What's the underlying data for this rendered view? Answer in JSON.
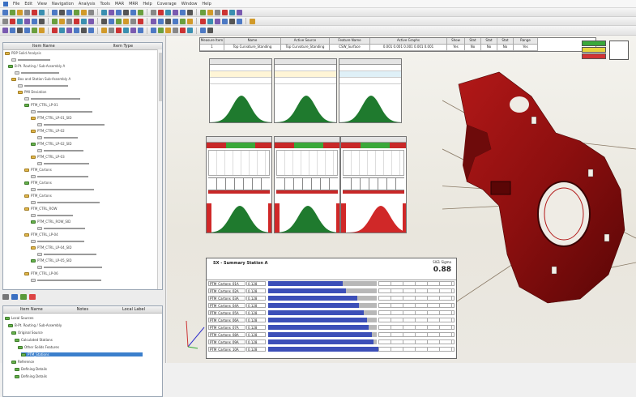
{
  "menubar": {
    "items": [
      "File",
      "Edit",
      "View",
      "Navigation",
      "Analysis",
      "Tools",
      "MAR",
      "MRR",
      "Help",
      "Coverage",
      "Window",
      "Help"
    ]
  },
  "toolbars": {
    "row_count": 3
  },
  "tree_panel": {
    "header_left": "Item Name",
    "header_right": "Item Type",
    "rows": [
      "PDP Solid Analysis",
      "B-Pt. Routing / Sub-Assembly A",
      "Box and Station Sub-Assembly A",
      "PMI Deviation",
      "PTM_CTRL_LP-01",
      "PTM_CTRL_LP-01_SID",
      "PTM_CTRL_LP-02",
      "PTM_CTRL_LP-02_SID",
      "PTM_CTRL_LP-03",
      "PTM_Cartons",
      "PTM_Cartons",
      "PTM_Cartons",
      "PTM_CTRL_ROW",
      "PTM_CTRL_ROW_SID",
      "PTM_CTRL_LP-04",
      "PTM_CTRL_LP-04_SID",
      "PTM_CTRL_LP-05_SID",
      "PTM_CTRL_LP-06"
    ]
  },
  "lower_panel": {
    "header_cols": [
      "Item Name",
      "Notes",
      "Local Label"
    ],
    "rows": [
      "Local Sources",
      "B-Pt. Routing / Sub-Assembly",
      "Original Source",
      "Calculated Stations",
      "Other Solids Features",
      "PTM_Stations",
      "Reference",
      "Defining Details",
      "Defining Details"
    ]
  },
  "info_table": {
    "headers": [
      "Measure Item",
      "Name",
      "Active Source",
      "Feature Name",
      "Active Graphs",
      "Show",
      "Stat",
      "Stat",
      "Stat",
      "Range"
    ],
    "values": [
      "1",
      "Top Curvature_Standing",
      "Top Curvature_Standing",
      "CSW_Surface",
      "0.001 0.001 0.001 0.001 0.001",
      "Yes",
      "No",
      "No",
      "No",
      "Yes"
    ]
  },
  "legend_colors": {
    "ok": "#3aa83a",
    "warn": "#e6d43c",
    "bad": "#d23434"
  },
  "summary": {
    "title": "SX - Summary Station A",
    "value_label": "SIG",
    "value": "0.88",
    "subtitle": "1 Sigma",
    "rows": [
      {
        "name": "PTM_Cartons_01A",
        "val": "0.128"
      },
      {
        "name": "PTM_Cartons_02A",
        "val": "0.128"
      },
      {
        "name": "PTM_Cartons_03A",
        "val": "0.128"
      },
      {
        "name": "PTM_Cartons_04A",
        "val": "0.128"
      },
      {
        "name": "PTM_Cartons_05A",
        "val": "0.128"
      },
      {
        "name": "PTM_Cartons_06A",
        "val": "0.128"
      },
      {
        "name": "PTM_Cartons_07A",
        "val": "0.128"
      },
      {
        "name": "PTM_Cartons_08A",
        "val": "0.128"
      },
      {
        "name": "PTM_Cartons_09A",
        "val": "0.128"
      },
      {
        "name": "PTM_Cartons_10A",
        "val": "0.128"
      }
    ]
  }
}
